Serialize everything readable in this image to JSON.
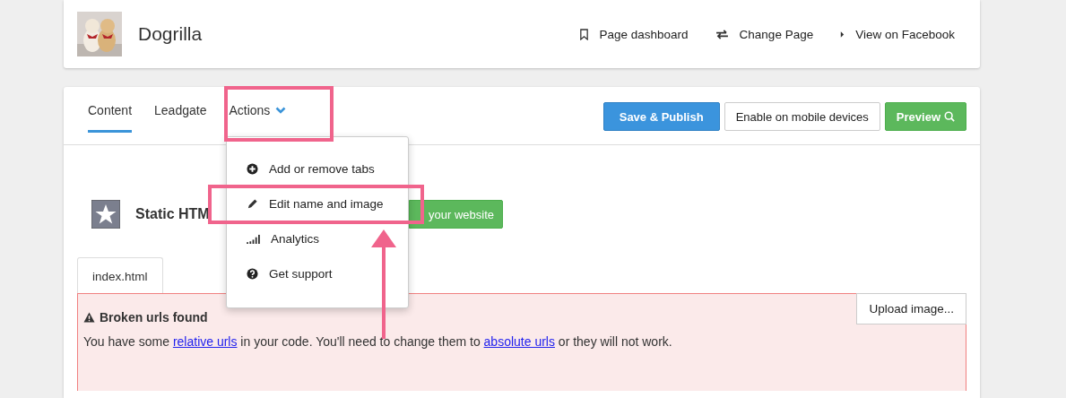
{
  "page": {
    "name": "Dogrilla"
  },
  "header_links": [
    {
      "label": "Page dashboard"
    },
    {
      "label": "Change Page"
    },
    {
      "label": "View on Facebook"
    }
  ],
  "tabs": [
    {
      "label": "Content",
      "selected": true,
      "kind": "tab"
    },
    {
      "label": "Leadgate",
      "selected": false,
      "kind": "tab"
    },
    {
      "label": "Actions",
      "selected": false,
      "kind": "dropdown",
      "expanded": true
    }
  ],
  "buttons": [
    {
      "label": "Save & Publish",
      "kind": "primary"
    },
    {
      "label": "Enable on mobile devices",
      "kind": "default"
    },
    {
      "label": "Preview",
      "kind": "success"
    }
  ],
  "actions_menu": [
    {
      "label": "Add or remove tabs"
    },
    {
      "label": "Edit name and image"
    },
    {
      "label": "Analytics"
    },
    {
      "label": "Get support"
    }
  ],
  "app": {
    "title": "Static HTM",
    "button": "your website"
  },
  "file_tabs": [
    {
      "label": "index.html",
      "selected": true
    }
  ],
  "alert": {
    "title": "Broken urls found",
    "message": [
      {
        "kind": "text",
        "text": "You have some "
      },
      {
        "kind": "link",
        "text": "relative urls"
      },
      {
        "kind": "text",
        "text": " in your code. You'll need to change them to "
      },
      {
        "kind": "link",
        "text": "absolute urls"
      },
      {
        "kind": "text",
        "text": " or they will not work."
      }
    ]
  },
  "upload_button": "Upload image..."
}
